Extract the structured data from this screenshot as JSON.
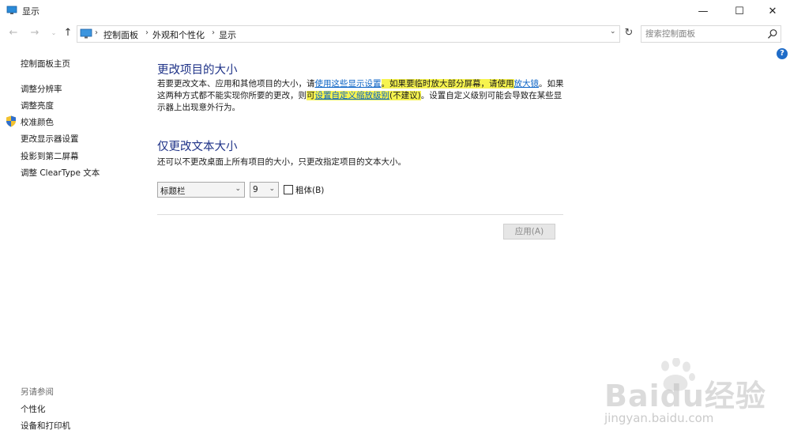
{
  "window": {
    "title": "显示",
    "minimize_glyph": "—",
    "maximize_glyph": "☐",
    "close_glyph": "✕"
  },
  "nav": {
    "back_glyph": "←",
    "forward_glyph": "→",
    "recent_glyph": "⌄",
    "up_glyph": "↑",
    "breadcrumbs": [
      "控制面板",
      "外观和个性化",
      "显示"
    ],
    "separator": "›",
    "dropdown_glyph": "⌄",
    "refresh_glyph": "↻",
    "search_placeholder": "搜索控制面板"
  },
  "help": {
    "glyph": "?"
  },
  "sidebar": {
    "home": "控制面板主页",
    "items": [
      "调整分辨率",
      "调整亮度",
      "校准颜色",
      "更改显示器设置",
      "投影到第二屏幕",
      "调整 ClearType 文本"
    ],
    "see_also_title": "另请参阅",
    "see_also": [
      "个性化",
      "设备和打印机"
    ]
  },
  "main": {
    "heading1": "更改项目的大小",
    "para": {
      "p1": "若要更改文本、应用和其他项目的大小，请",
      "link1": "使用这些显示设置",
      "p2": "。如果要临时放大部分屏幕，请使用",
      "link2": "放大镜",
      "p3": "。如果这两种方式都不能实现你所要的更改，则",
      "link3_prefix": "可",
      "link3": "设置自定义缩放级别",
      "link3_suffix": "(不建议)",
      "p4": "。设置自定义级别可能会导致在某些显示器上出现意外行为。"
    },
    "heading2": "仅更改文本大小",
    "desc2": "还可以不更改桌面上所有项目的大小，只更改指定项目的文本大小。",
    "item_select": "标题栏",
    "size_select": "9",
    "select_arrow": "⌄",
    "bold_label": "粗体(B)",
    "bold_checked": false,
    "apply_label": "应用(A)"
  },
  "watermark": {
    "brand": "Baidu经验",
    "url": "jingyan.baidu.com"
  },
  "colors": {
    "heading": "#1e3287",
    "link": "#0b63c5",
    "highlight": "#f6f34f",
    "help": "#1f6cc8"
  }
}
